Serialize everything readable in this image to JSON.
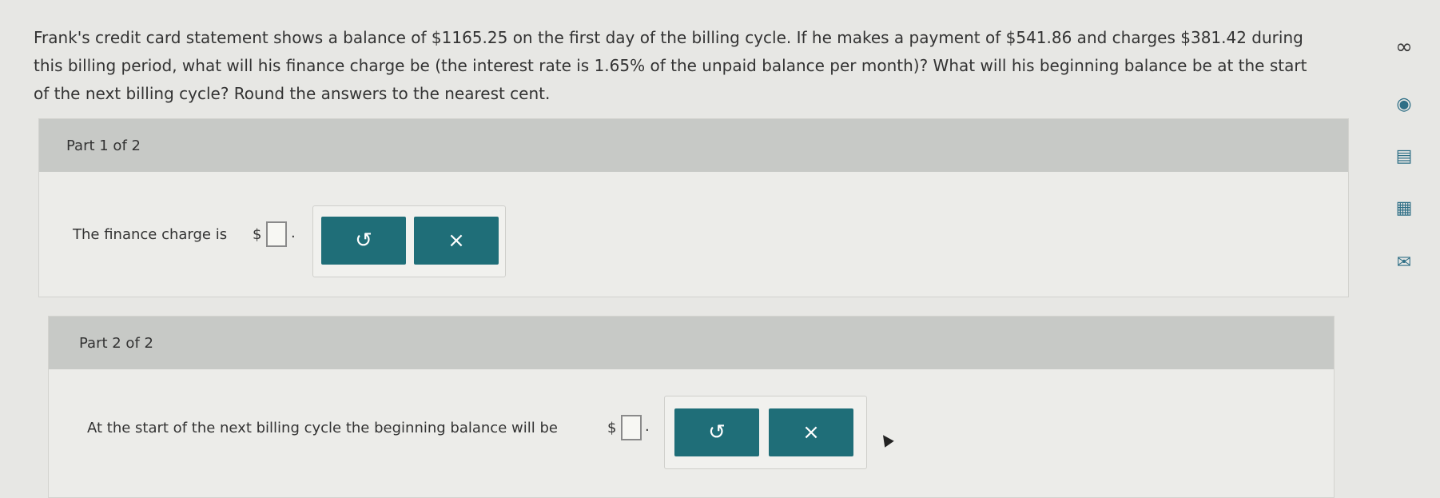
{
  "question": {
    "line1": "Frank's credit card statement shows a balance of $1165.25 on the first day of the billing cycle. If he makes a payment of $541.86 and charges $381.42 during",
    "line2": "this billing period, what will his finance charge be (the interest rate is 1.65% of the unpaid balance per month)? What will his beginning balance be at the start",
    "line3": "of the next billing cycle? Round the answers to the nearest cent."
  },
  "part1": {
    "header": "Part 1 of 2",
    "prompt": "The finance charge is",
    "currency": "$",
    "end_punct": ".",
    "undo_icon": "undo-icon",
    "clear_icon": "close-icon",
    "undo_glyph": "↺",
    "clear_glyph": "×"
  },
  "part2": {
    "header": "Part 2 of 2",
    "prompt": "At the start of the next billing cycle the beginning balance will be",
    "currency": "$",
    "end_punct": ".",
    "undo_icon": "undo-icon",
    "clear_icon": "close-icon",
    "undo_glyph": "↺",
    "clear_glyph": "×"
  },
  "rail": {
    "infinity_glyph": "∞",
    "check_glyph": "◉",
    "doc_glyph": "▤",
    "calc_glyph": "▦",
    "mail_glyph": "✉"
  },
  "colors": {
    "accent": "#1f6e78",
    "header_bg": "#c7c9c6",
    "page_bg": "#e7e7e4"
  }
}
